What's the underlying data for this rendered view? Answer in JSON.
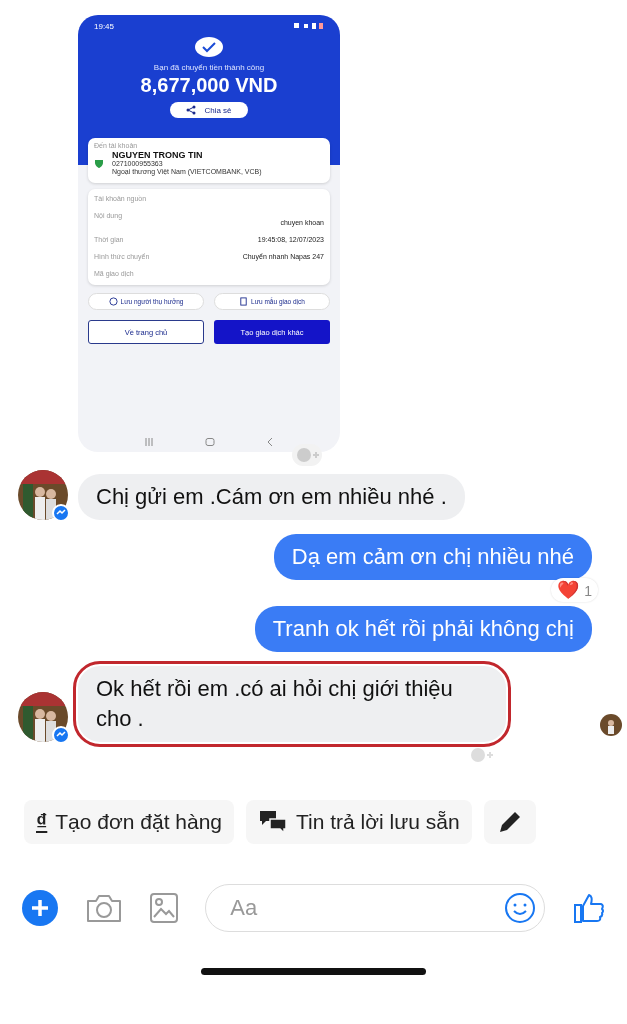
{
  "transfer_screenshot": {
    "status_time": "19:45",
    "success_text": "Bạn đã chuyển tiền thành công",
    "amount": "8,677,000 VND",
    "share_button": "Chia sẻ",
    "recipient": {
      "label": "Đến tài khoản",
      "name": "NGUYEN TRONG TIN",
      "account": "0271000955363",
      "bank": "Ngoại thương Việt Nam (VIETCOMBANK, VCB)"
    },
    "details": [
      {
        "label": "Tài khoản nguồn"
      },
      {
        "label": "Nội dung",
        "value": "chuyen khoan"
      },
      {
        "label": "Thời gian",
        "value": "19:45:08, 12/07/2023"
      },
      {
        "label": "Hình thức chuyển",
        "value": "Chuyển nhanh Napas 247"
      },
      {
        "label": "Mã giao dịch"
      }
    ],
    "save_buttons": [
      {
        "kind": "person",
        "label": "Lưu người thụ hưởng"
      },
      {
        "kind": "template",
        "label": "Lưu mẫu giao dịch"
      }
    ],
    "home_button": "Về trang chủ",
    "new_transaction_button": "Tạo giao dịch khác"
  },
  "messages": [
    {
      "kind": "received",
      "text": "Chị gửi em .Cám ơn em nhiều nhé .",
      "highlighted": false
    },
    {
      "kind": "sent",
      "text": "Dạ em cảm ơn chị nhiều nhé",
      "highlighted": false,
      "reaction": {
        "emoji": "❤️",
        "count": "1"
      }
    },
    {
      "kind": "sent",
      "text": "Tranh ok hết rồi phải không chị",
      "highlighted": false
    },
    {
      "kind": "received",
      "text": "Ok hết rồi em .có ai hỏi chị giới thiệu cho .",
      "highlighted": true
    }
  ],
  "quick_actions": [
    {
      "kind": "order",
      "icon": "₫",
      "label": "Tạo đơn đặt hàng"
    },
    {
      "kind": "saved",
      "label": "Tin trả lời lưu sẵn"
    },
    {
      "kind": "edit"
    }
  ],
  "composer": {
    "placeholder": "Aa"
  }
}
